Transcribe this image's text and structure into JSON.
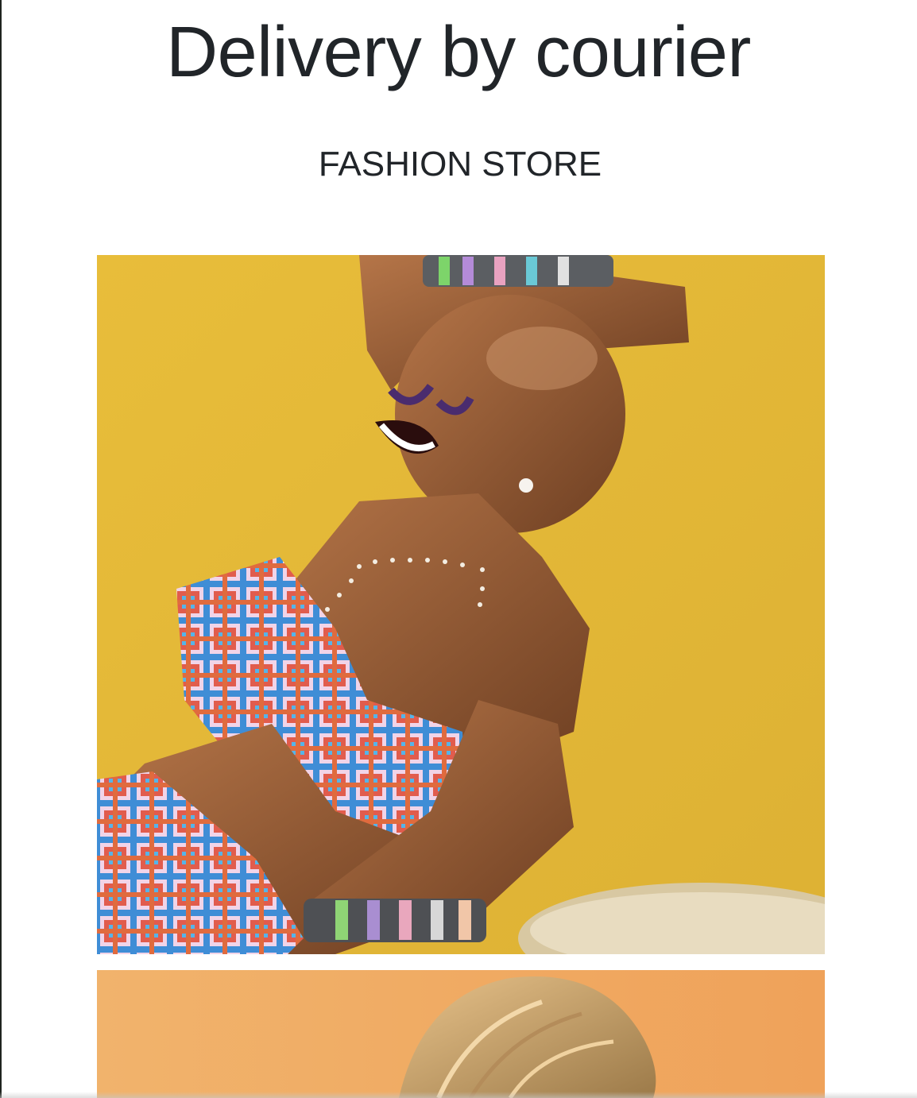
{
  "page": {
    "title": "Delivery by courier",
    "subtitle": "FASHION STORE"
  },
  "gallery": {
    "images": [
      {
        "name": "model-yellow-backdrop-photo",
        "backdrop_color": "#E5B935",
        "outfit_colors": [
          "#3E8CD6",
          "#E2574B",
          "#F2D3E6"
        ]
      },
      {
        "name": "model-orange-backdrop-photo",
        "backdrop_color": "#F2A55E",
        "hair_color": "#D7A869"
      }
    ]
  },
  "colors": {
    "text": "#212529",
    "background": "#FFFFFF"
  }
}
